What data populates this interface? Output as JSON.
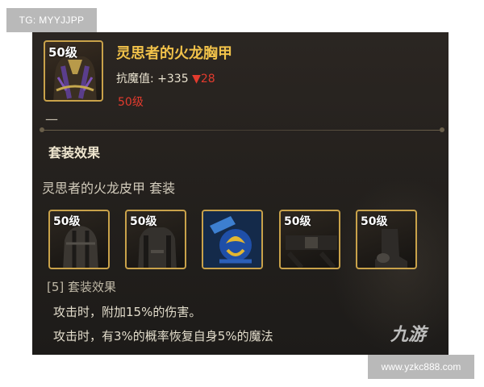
{
  "watermark_top_left": "TG: MYYJJPP",
  "watermark_bottom_right": "www.yzkc888.com",
  "item": {
    "level": "50级",
    "name": "灵思者的火龙胸甲",
    "stat_label": "抗魔值:",
    "stat_value": "+335",
    "stat_change": "▼28",
    "level_requirement": "50级",
    "dash": "—"
  },
  "set_section": {
    "title": "套装效果",
    "set_name": "灵思者的火龙皮甲  套装",
    "pieces": [
      {
        "level": "50级",
        "icon": "helmet-icon"
      },
      {
        "level": "50级",
        "icon": "chest-armor-icon"
      },
      {
        "level": "",
        "icon": "shoulder-armor-icon"
      },
      {
        "level": "50级",
        "icon": "belt-icon"
      },
      {
        "level": "50级",
        "icon": "boots-icon"
      }
    ],
    "bonus_header": "[5] 套装效果",
    "bonus_lines": [
      "攻击时，附加15%的伤害。",
      "攻击时，有3%的概率恢复自身5%的魔法"
    ]
  },
  "brand_logo": "九游",
  "colors": {
    "gold_title": "#f1c24a",
    "frame_gold": "#c9a24a",
    "red_text": "#e33b2e",
    "panel_bg": "#231f1c"
  }
}
